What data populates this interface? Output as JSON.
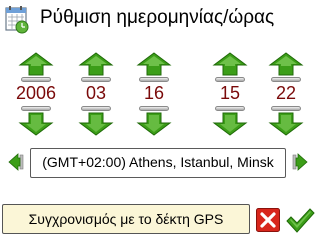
{
  "header": {
    "title": "Ρύθμιση ημερομηνίας/ώρας",
    "icon": "calendar-clock-icon"
  },
  "spinners": [
    {
      "value": "2006"
    },
    {
      "value": "03"
    },
    {
      "value": "16"
    },
    {
      "value": "15"
    },
    {
      "value": "22"
    }
  ],
  "timezone": {
    "label": "(GMT+02:00) Athens, Istanbul, Minsk"
  },
  "gps_sync": {
    "label": "Συγχρονισμός με το δέκτη GPS"
  },
  "colors": {
    "value_text": "#7a0a0a",
    "arrow_green": "#3c9e18",
    "cancel_red": "#d8261c",
    "gps_button_bg": "#fbf6d7"
  }
}
